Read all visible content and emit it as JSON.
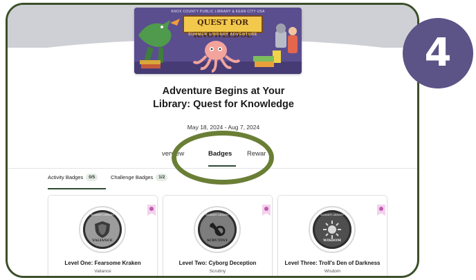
{
  "banner": {
    "library_line": "KNOX COUNTY PUBLIC LIBRARY & KEAN CITY USA",
    "title": "QUEST FOR KNOWLEDGE",
    "tagline": "SUMMER LIBRARY ADVENTURE"
  },
  "program": {
    "title": "Adventure Begins at Your Library: Quest for Knowledge",
    "dates": "May 18, 2024 - Aug 7, 2024"
  },
  "tabs": [
    {
      "label": "verview",
      "active": false
    },
    {
      "label": "Badges",
      "active": true
    },
    {
      "label": "Rewar",
      "active": false
    }
  ],
  "subtabs": [
    {
      "label": "Activity Badges",
      "count": "0/5",
      "active": true
    },
    {
      "label": "Challenge Badges",
      "count": "1/2",
      "active": false
    }
  ],
  "badges": [
    {
      "name": "Level One: Fearsome Kraken",
      "category": "Valiance",
      "emblem_text": "VALIANCE",
      "ring_text": "SUMMER LIBRARY",
      "icon": "shield-icon"
    },
    {
      "name": "Level Two: Cyborg Deception",
      "category": "Scrutiny",
      "emblem_text": "SCRUTINY",
      "ring_text": "SUMMER LIBRARY",
      "icon": "wrench-gear-icon"
    },
    {
      "name": "Level Three: Troll's Den of Darkness",
      "category": "Wisdom",
      "emblem_text": "WISDOM",
      "ring_text": "SUMMER LIBRARY",
      "icon": "sun-icon"
    }
  ],
  "step": {
    "number": "4"
  },
  "colors": {
    "frame": "#3b4f2a",
    "highlight_ring": "#6a7f35",
    "step_circle": "#5c5387",
    "active_tab_underline": "#2f4a34",
    "bookmark": "#f3d1ec"
  }
}
